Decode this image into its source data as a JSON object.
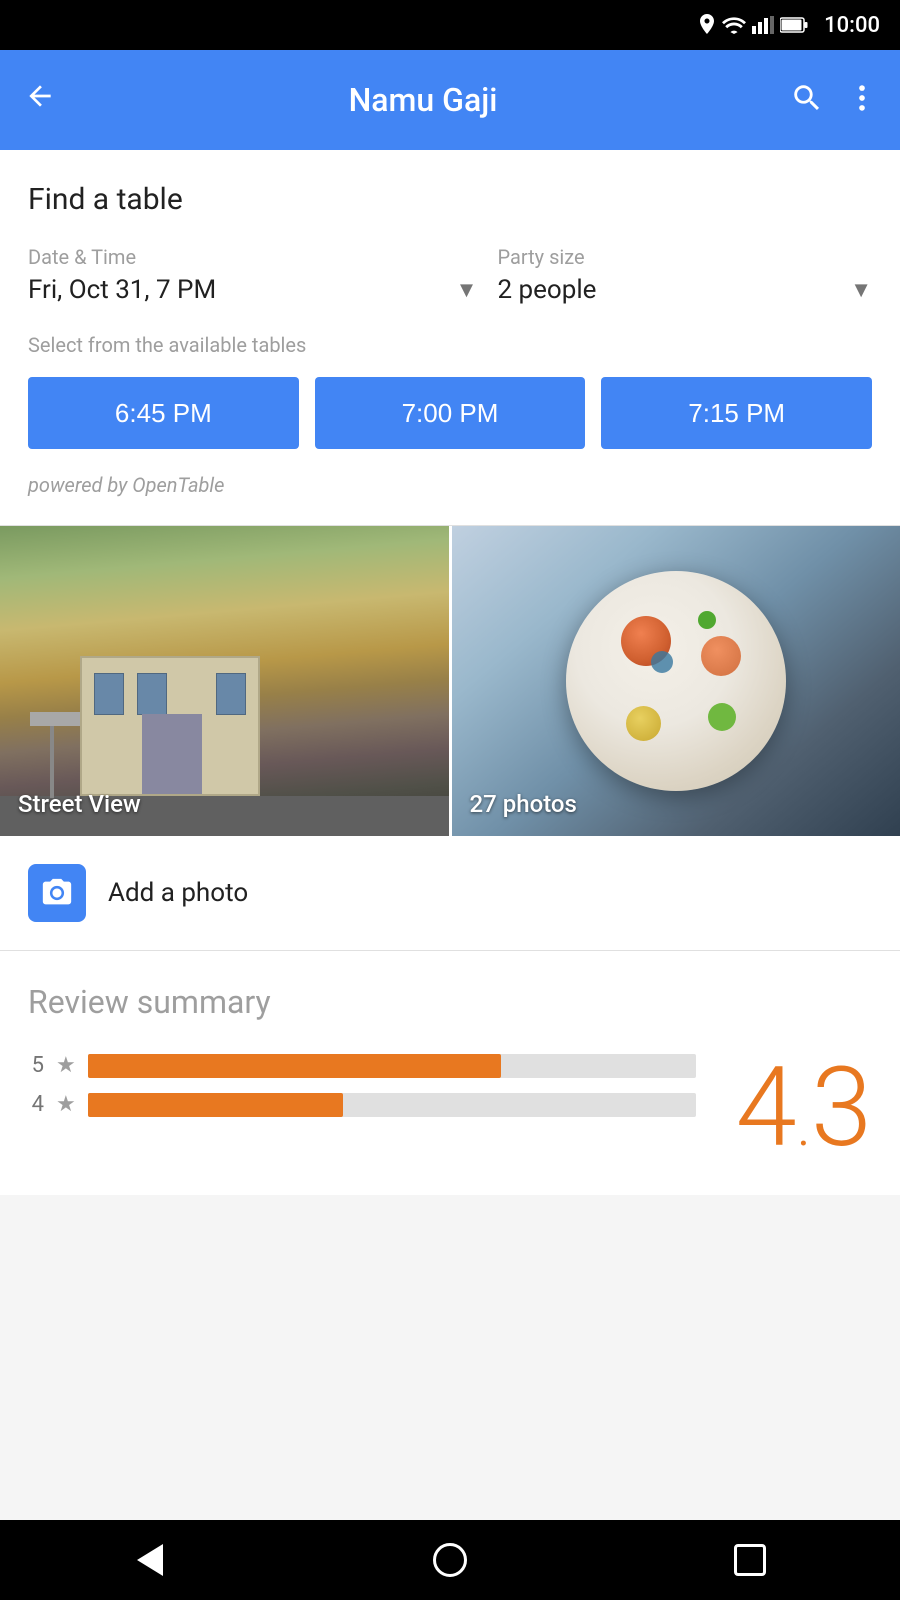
{
  "statusBar": {
    "time": "10:00",
    "icons": [
      "location",
      "wifi",
      "signal",
      "battery"
    ]
  },
  "appBar": {
    "backLabel": "←",
    "title": "Namu Gaji",
    "searchIcon": "search",
    "moreIcon": "more-vert"
  },
  "findTable": {
    "sectionTitle": "Find a table",
    "dateTimeLabel": "Date & Time",
    "dateTimeValue": "Fri, Oct 31, 7 PM",
    "partySizeLabel": "Party size",
    "partySizeValue": "2 people",
    "availableTablesLabel": "Select from the available tables",
    "timeSlots": [
      "6:45 PM",
      "7:00 PM",
      "7:15 PM"
    ],
    "poweredBy": "powered by OpenTable"
  },
  "gallery": {
    "streetViewLabel": "Street View",
    "photosLabel": "27 photos"
  },
  "addPhoto": {
    "label": "Add a photo"
  },
  "reviewSummary": {
    "title": "Review summary",
    "ratingBars": [
      {
        "stars": 5,
        "widthPercent": 68
      },
      {
        "stars": 4,
        "widthPercent": 42
      }
    ],
    "scoreWhole": "4",
    "scoreFraction": "3"
  },
  "bottomNav": {
    "back": "back",
    "home": "home",
    "recents": "recents"
  }
}
